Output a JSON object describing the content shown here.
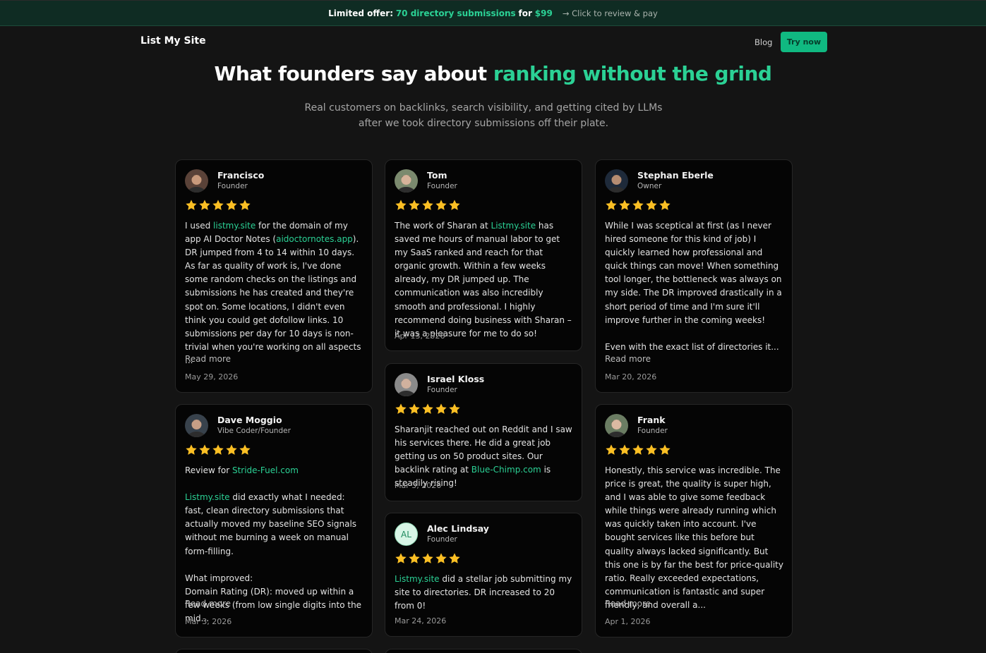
{
  "banner": {
    "label": "Limited offer:",
    "offer": "70 directory submissions",
    "for_word": "for",
    "price": "$99",
    "cta": "→ Click to review & pay"
  },
  "nav": {
    "logo": "List My Site",
    "blog": "Blog",
    "try_now": "Try now"
  },
  "hero": {
    "title_plain": "What founders say about ",
    "title_accent": "ranking without the grind",
    "subtitle": "Real customers on backlinks, search visibility, and getting cited by LLMs after we took directory submissions off their plate."
  },
  "colors": {
    "accent": "#2bd195",
    "button": "#10b981",
    "star": "#fbbf24",
    "background": "#141414",
    "card": "#050505"
  },
  "star_rating_max": 5,
  "testimonials": [
    {
      "name": "Francisco",
      "role": "Founder",
      "rating": 5,
      "review_parts": [
        {
          "t": "I used "
        },
        {
          "t": "listmy.site",
          "link": true
        },
        {
          "t": " for the domain of my app AI Doctor Notes ("
        },
        {
          "t": "aidoctornotes.app",
          "link": true
        },
        {
          "t": "). DR jumped from 4 to 14 within 10 days. As far as quality of work is, I've done some random checks on the listings and submissions he has created and they're spot on. Some locations, I didn't even think you could get dofollow links. 10 submissions per day for 10 days is non-trivial when you're working on all aspects ..."
        }
      ],
      "read_more": "Read more",
      "date": "May 29, 2026",
      "avatar_icon": "person-photo-icon"
    },
    {
      "name": "Tom",
      "role": "Founder",
      "rating": 5,
      "review_parts": [
        {
          "t": "The work of Sharan at "
        },
        {
          "t": "Listmy.site",
          "link": true
        },
        {
          "t": " has saved me hours of manual labor to get my SaaS ranked and reach for that organic growth. Within a few weeks already, my DR jumped up. The communication was also incredibly smooth and professional. I highly recommend doing business with Sharan – it was a pleasure for me to do so!"
        }
      ],
      "date": "Apr 13, 2026",
      "avatar_icon": "person-photo-icon"
    },
    {
      "name": "Stephan Eberle",
      "role": "Owner",
      "rating": 5,
      "review_parts": [
        {
          "t": "While I was sceptical at first (as I never hired someone for this kind of job) I quickly learned how professional and quick things can move! When something tool longer, the bottleneck was always on my side. The DR improved drastically in a short period of time and I'm sure it'll improve further in the coming weeks!\n\nEven with the exact list of directories it..."
        }
      ],
      "read_more": "Read more",
      "date": "Mar 20, 2026",
      "avatar_icon": "person-photo-icon"
    },
    {
      "name": "Dave Moggio",
      "role": "Vibe Coder/Founder",
      "rating": 5,
      "review_parts": [
        {
          "t": "Review for "
        },
        {
          "t": "Stride-Fuel.com",
          "link": true
        },
        {
          "t": "\n\n"
        },
        {
          "t": "Listmy.site",
          "link": true
        },
        {
          "t": " did exactly what I needed: fast, clean directory submissions that actually moved my baseline SEO signals without me burning a week on manual form-filling.\n\nWhat improved:\nDomain Rating (DR): moved up within a few weeks (from low single digits into the mid..."
        }
      ],
      "read_more": "Read more",
      "date": "Mar 3, 2026",
      "avatar_icon": "person-photo-icon"
    },
    {
      "name": "Israel Kloss",
      "role": "Founder",
      "rating": 5,
      "review_parts": [
        {
          "t": "Sharanjit reached out on Reddit and I saw his services there. He did a great job getting us on 50 product sites. Our backlink rating at "
        },
        {
          "t": "Blue-Chimp.com",
          "link": true
        },
        {
          "t": " is steadily rising!"
        }
      ],
      "date": "Mar 3, 2026",
      "avatar_icon": "person-photo-icon"
    },
    {
      "name": "Frank",
      "role": "Founder",
      "rating": 5,
      "review_parts": [
        {
          "t": "Honestly, this service was incredible. The price is great, the quality is super high, and I was able to give some feedback while things were already running which was quickly taken into account. I've bought services like this before but quality always lacked significantly. But this one is by far the best for price-quality ratio. Really exceeded expectations, communication is fantastic and super friendly, and overall a..."
        }
      ],
      "read_more": "Read more",
      "date": "Apr 1, 2026",
      "avatar_icon": "person-photo-icon"
    },
    {
      "name": "Alec Lindsay",
      "role": "Founder",
      "rating": 5,
      "initials": "AL",
      "review_parts": [
        {
          "t": "Listmy.site",
          "link": true
        },
        {
          "t": " did a stellar job submitting my site to directories. DR increased to 20 from 0!"
        }
      ],
      "date": "Mar 24, 2026",
      "avatar_icon": "initials-avatar-icon"
    }
  ]
}
